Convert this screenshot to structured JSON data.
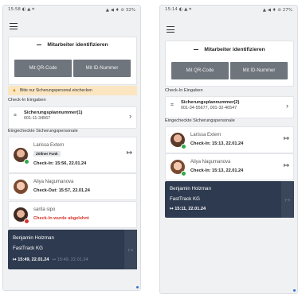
{
  "left": {
    "status_time": "15:58 ◐ ▲ ⌗",
    "status_right": "▲ ◀ ♦ ⊘ 32%",
    "ident_title": "Mitarbeiter identifizieren",
    "btn_qr": "Mit QR-Code",
    "btn_id": "Mit ID-Nummer",
    "warning": "Bitte nur Sicherungspersonal einchecken",
    "checkin_label": "Check-In Eingaben",
    "plan_title": "Sicherungsplannummer(1)",
    "plan_numbers": "001-11-34567",
    "checked_label": "Eingecheckte Sicherungspersonale",
    "persons": [
      {
        "name": "Larissa Extern",
        "badge": "Zöllner Funk",
        "time": "Check-In: 15:56, 22.01.24",
        "status": "green"
      },
      {
        "name": "Aliya Nagumanova",
        "time": "Check-Out: 15:57, 22.01.24",
        "status": "none"
      },
      {
        "name": "sarita sipo",
        "time": "Check-In wurde abgelehnt",
        "status": "red"
      }
    ],
    "dark": {
      "name": "Benjamin Holzman",
      "company": "FastTrack KG",
      "time": "15:49, 22.01.24",
      "time2": "15:49, 22.01.24"
    }
  },
  "right": {
    "status_time": "15:14 ◐ ▲ ⌗",
    "status_right": "▲ ◀ ♦ ⊘ 27%",
    "ident_title": "Mitarbeiter identifizieren",
    "btn_qr": "Mit QR-Code",
    "btn_id": "Mit ID-Nummer",
    "checkin_label": "Check-In Eingaben",
    "plan_title": "Sicherungsplannummer(2)",
    "plan_numbers": "001-34-55677, 001-32-46547",
    "checked_label": "Eingecheckte Sicherungspersonale",
    "persons": [
      {
        "name": "Larissa Extern",
        "time": "Check-In: 15:13, 22.01.24",
        "status": "green"
      },
      {
        "name": "Aliya Nagumanova",
        "time": "Check-In: 15:13, 22.01.24",
        "status": "green"
      }
    ],
    "dark": {
      "name": "Benjamin Holzman",
      "company": "FastTrack KG",
      "time": "15:11, 22.01.24"
    }
  },
  "icons": {
    "menu": "hamburger-icon",
    "chevron": "chevron-right-icon",
    "logout": "logout-icon",
    "warning": "warning-icon",
    "checkin": "clipboard-icon",
    "entry": "login-icon"
  }
}
